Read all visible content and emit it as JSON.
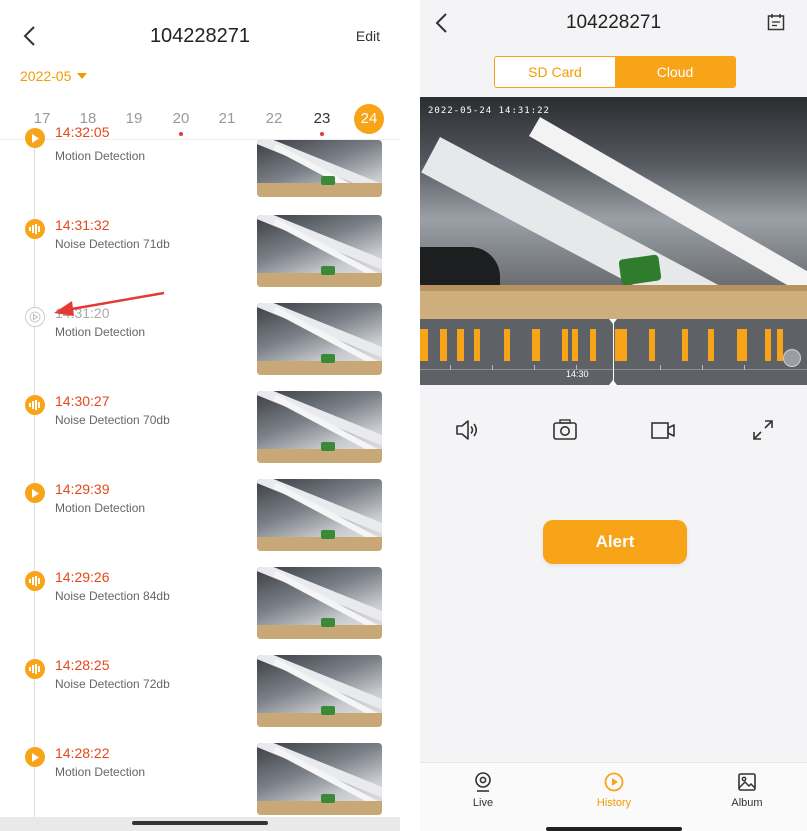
{
  "left_panel": {
    "title": "104228271",
    "edit_label": "Edit",
    "month": "2022-05",
    "dates": [
      {
        "label": "17",
        "dot": false
      },
      {
        "label": "18",
        "dot": false
      },
      {
        "label": "19",
        "dot": false
      },
      {
        "label": "20",
        "dot": true
      },
      {
        "label": "21",
        "dot": false
      },
      {
        "label": "22",
        "dot": false
      },
      {
        "label": "23",
        "dot": true
      },
      {
        "label": "24",
        "dot": false,
        "selected": true
      }
    ],
    "events": [
      {
        "time": "14:32:05",
        "desc": "Motion Detection",
        "icon": "play-icon"
      },
      {
        "time": "14:31:32",
        "desc": "Noise Detection 71db",
        "icon": "sound-icon"
      },
      {
        "time": "14:31:20",
        "desc": "Motion Detection",
        "icon": "play-outline-icon"
      },
      {
        "time": "14:30:27",
        "desc": "Noise Detection 70db",
        "icon": "sound-icon"
      },
      {
        "time": "14:29:39",
        "desc": "Motion Detection",
        "icon": "play-icon"
      },
      {
        "time": "14:29:26",
        "desc": "Noise Detection 84db",
        "icon": "sound-icon"
      },
      {
        "time": "14:28:25",
        "desc": "Noise Detection 72db",
        "icon": "sound-icon"
      },
      {
        "time": "14:28:22",
        "desc": "Motion Detection",
        "icon": "play-icon"
      }
    ]
  },
  "right_panel": {
    "title": "104228271",
    "segments": [
      "SD Card",
      "Cloud"
    ],
    "active_segment": "Cloud",
    "video_timestamp": "2022-05-24 14:31:22",
    "timeline_label": "14:30",
    "controls": [
      "speaker-icon",
      "camera-icon",
      "record-icon",
      "fullscreen-icon"
    ],
    "alert_label": "Alert",
    "tabs": [
      {
        "label": "Live",
        "icon": "webcam-icon"
      },
      {
        "label": "History",
        "icon": "history-play-icon",
        "active": true
      },
      {
        "label": "Album",
        "icon": "album-icon"
      }
    ]
  },
  "colors": {
    "accent": "#f7a418",
    "event_time": "#e4481a",
    "pointer_arrow": "#e53935"
  }
}
